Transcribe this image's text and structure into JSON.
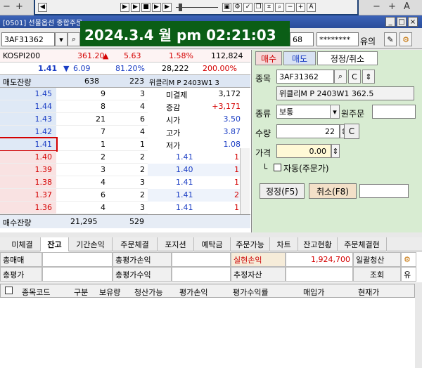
{
  "window": {
    "title": "[0501] 선물옵션 종합주문"
  },
  "clock": "2024.3.4 월 pm 02:21:03",
  "toolbar": {
    "minus": "−",
    "plus": "+",
    "a": "A"
  },
  "account": {
    "code": "3AF31362",
    "qty_text": "68",
    "password": "********",
    "save_label": "유의"
  },
  "quote": {
    "kospi_label": "KOSPI200",
    "kospi": "361.20",
    "kospi_change": "5.63",
    "kospi_rate": "1.58%",
    "kospi_vol": "112,824",
    "price": "1.41",
    "change": "6.09",
    "rate": "81.20%",
    "volume": "28,222",
    "ratio": "200.00%"
  },
  "orderbook": {
    "ask_header": "매도잔량",
    "ask_total": "638",
    "ask_count": "223",
    "instrument": "위클리M P 2403W1 3",
    "asks": [
      {
        "price": "1.45",
        "qty": "9",
        "cnt": "3"
      },
      {
        "price": "1.44",
        "qty": "8",
        "cnt": "4"
      },
      {
        "price": "1.43",
        "qty": "21",
        "cnt": "6"
      },
      {
        "price": "1.42",
        "qty": "7",
        "cnt": "4"
      },
      {
        "price": "1.41",
        "qty": "1",
        "cnt": "1"
      }
    ],
    "bids": [
      {
        "price": "1.40",
        "qty": "2",
        "cnt": "2"
      },
      {
        "price": "1.39",
        "qty": "3",
        "cnt": "2"
      },
      {
        "price": "1.38",
        "qty": "4",
        "cnt": "3"
      },
      {
        "price": "1.37",
        "qty": "6",
        "cnt": "2"
      },
      {
        "price": "1.36",
        "qty": "4",
        "cnt": "3"
      }
    ],
    "info": [
      {
        "label": "미결제",
        "value": "3,172"
      },
      {
        "label": "증감",
        "value": "+3,171"
      },
      {
        "label": "시가",
        "value": "3.50"
      },
      {
        "label": "고가",
        "value": "3.87"
      },
      {
        "label": "저가",
        "value": "1.08"
      }
    ],
    "ticks": [
      {
        "price": "1.41",
        "qty": "1"
      },
      {
        "price": "1.40",
        "qty": "1"
      },
      {
        "price": "1.41",
        "qty": "1"
      },
      {
        "price": "1.41",
        "qty": "2"
      },
      {
        "price": "1.41",
        "qty": "1"
      },
      {
        "price": "1.41",
        "qty": "1"
      }
    ],
    "bid_header": "매수잔량",
    "bid_total": "21,295",
    "bid_count": "529"
  },
  "order": {
    "tabs": [
      "매수",
      "매도",
      "정정/취소"
    ],
    "code_label": "종목",
    "code": "3AF31362",
    "name": "위클리M P 2403W1 362.5",
    "type_label": "종류",
    "type": "보통",
    "orig_label": "원주문",
    "qty_label": "수량",
    "qty": "22",
    "price_label": "가격",
    "price": "0.00",
    "auto": "자동(주문가)",
    "modify_btn": "정정(F5)",
    "cancel_btn": "취소(F8)",
    "c_btn": "C"
  },
  "bottom_tabs": [
    "미체결",
    "잔고",
    "기간손익",
    "주문체결",
    "포지션",
    "예탁금",
    "주문가능",
    "차트",
    "잔고현황",
    "주문체결현"
  ],
  "summary": {
    "l1": "총매매",
    "l2": "총평가",
    "m1": "총평가손익",
    "m2": "총평가수익",
    "r1": "실현손익",
    "r1v": "1,924,700",
    "r2": "추정자산",
    "b1": "일괄청산",
    "b2": "조회",
    "b3": "유"
  },
  "grid_headers": [
    "종목코드",
    "구분",
    "보유량",
    "청산가능",
    "평가손익",
    "평가수익률",
    "매입가",
    "현재가"
  ]
}
